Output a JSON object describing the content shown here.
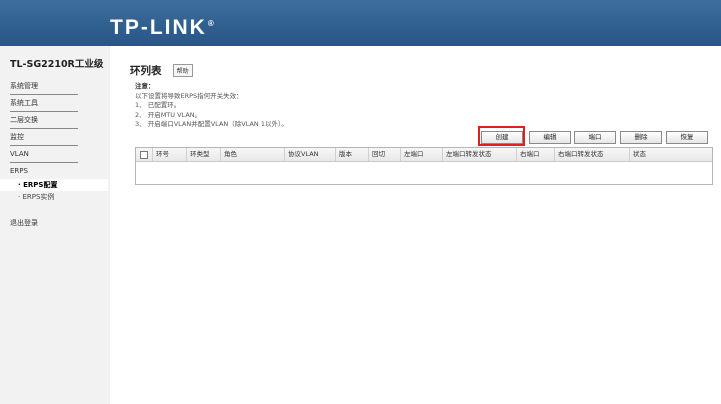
{
  "header": {
    "brand": "TP-LINK",
    "registered": "®"
  },
  "sidebar": {
    "model": "TL-SG2210R工业级",
    "items": [
      {
        "label": "系统管理"
      },
      {
        "label": "系统工具"
      },
      {
        "label": "二层交换"
      },
      {
        "label": "监控"
      },
      {
        "label": "VLAN"
      },
      {
        "label": "ERPS"
      }
    ],
    "subitems": [
      {
        "label": "· ERPS配置",
        "active": true
      },
      {
        "label": "· ERPS实例",
        "active": false
      }
    ],
    "logout": "退出登录"
  },
  "main": {
    "title": "环列表",
    "help": "帮助",
    "notice": {
      "title": "注意：",
      "intro": "以下设置将导致ERPS指何开关失效：",
      "lines": [
        "1、 已配置环。",
        "2、 开启MTU VLAN。",
        "3、 开启端口VLAN并配置VLAN（除VLAN 1以外）。"
      ]
    },
    "buttons": {
      "create": "创建",
      "edit": "编辑",
      "port": "端口",
      "delete": "删除",
      "restore": "恢复"
    },
    "table": {
      "columns": [
        "环号",
        "环类型",
        "角色",
        "协议VLAN",
        "版本",
        "回切",
        "左端口",
        "左端口转发状态",
        "右端口",
        "右端口转发状态",
        "状态"
      ]
    }
  },
  "colors": {
    "header": "#2f5f8f",
    "highlight": "#e02020",
    "sidebar": "#f2f2f2"
  }
}
